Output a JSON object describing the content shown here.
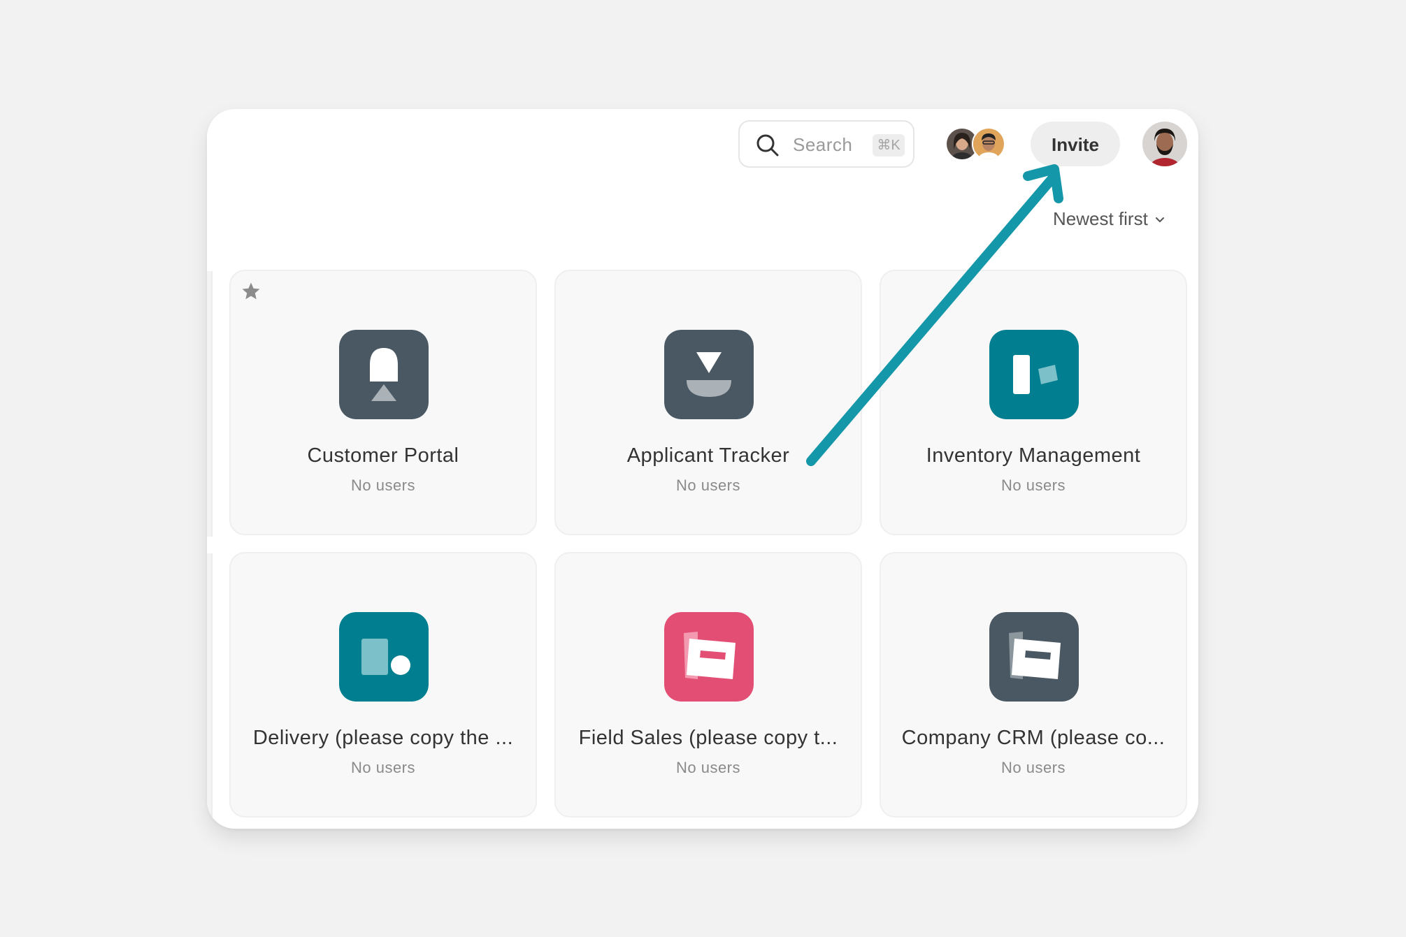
{
  "header": {
    "search": {
      "placeholder": "Search",
      "shortcut": "⌘K",
      "icon": "search-icon"
    },
    "collaborators": [
      "collaborator-avatar-1",
      "collaborator-avatar-2"
    ],
    "invite_label": "Invite",
    "user_avatar": "user-avatar"
  },
  "sort": {
    "label": "Newest first",
    "icon": "chevron-down-icon"
  },
  "apps": [
    {
      "name": "Customer Portal",
      "users": "No users",
      "starred": true,
      "icon": "bell-triangle-icon",
      "color": "#4a5863"
    },
    {
      "name": "Applicant Tracker",
      "users": "No users",
      "starred": false,
      "icon": "bowl-triangle-icon",
      "color": "#4a5863"
    },
    {
      "name": "Inventory Management",
      "users": "No users",
      "starred": false,
      "icon": "bar-diamond-icon",
      "color": "#017e8f"
    },
    {
      "name": "Delivery (please copy the ...",
      "users": "No users",
      "starred": false,
      "icon": "block-circle-icon",
      "color": "#017e8f"
    },
    {
      "name": "Field Sales (please copy t...",
      "users": "No users",
      "starred": false,
      "icon": "card-icon",
      "color": "#e34f74"
    },
    {
      "name": "Company CRM (please co...",
      "users": "No users",
      "starred": false,
      "icon": "card-icon",
      "color": "#4a5863"
    }
  ],
  "annotation": {
    "color": "#1497a8",
    "target": "Invite"
  }
}
